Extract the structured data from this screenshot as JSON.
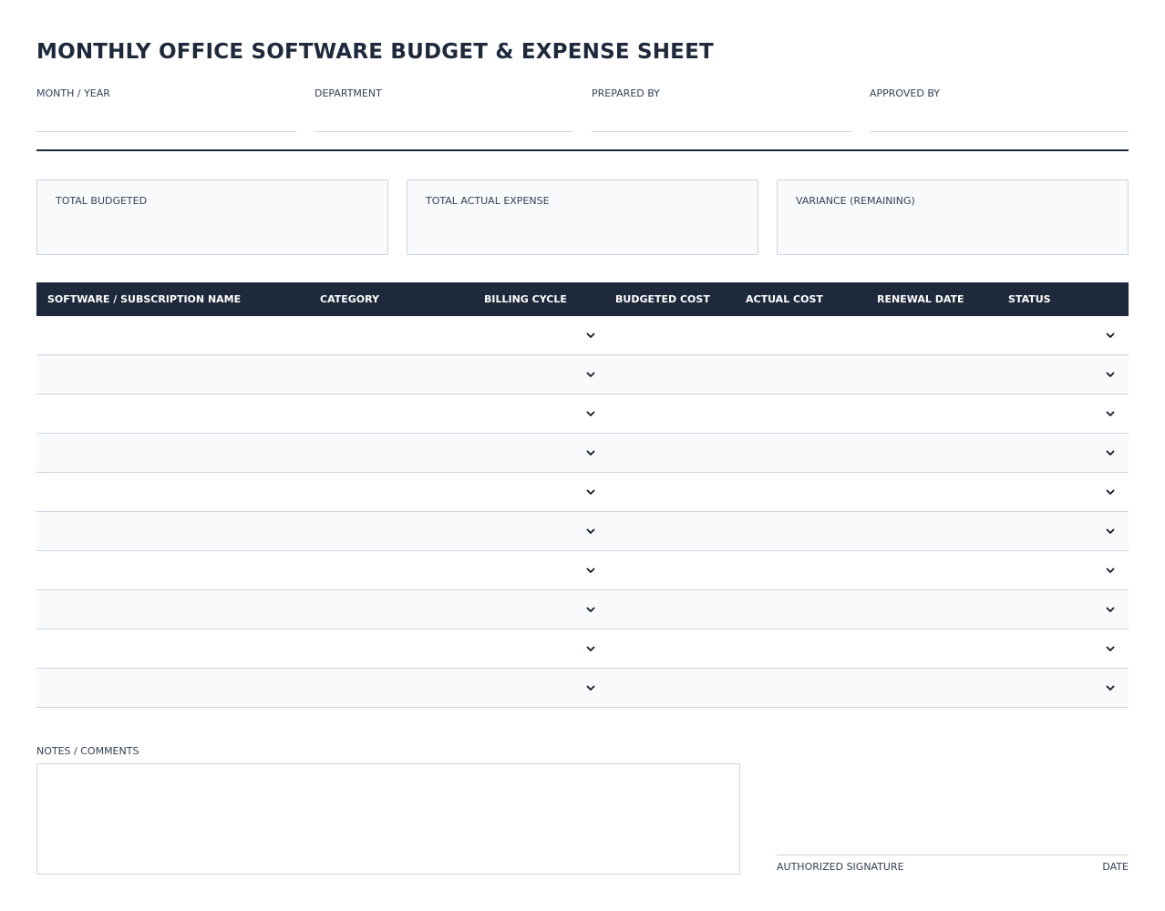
{
  "title": "MONTHLY OFFICE SOFTWARE BUDGET & EXPENSE SHEET",
  "header_fields": [
    {
      "label": "MONTH / YEAR",
      "value": ""
    },
    {
      "label": "DEPARTMENT",
      "value": ""
    },
    {
      "label": "PREPARED BY",
      "value": ""
    },
    {
      "label": "APPROVED BY",
      "value": ""
    }
  ],
  "summary": [
    {
      "label": "TOTAL BUDGETED",
      "value": ""
    },
    {
      "label": "TOTAL ACTUAL EXPENSE",
      "value": ""
    },
    {
      "label": "VARIANCE (REMAINING)",
      "value": ""
    }
  ],
  "table": {
    "columns": [
      "SOFTWARE / SUBSCRIPTION NAME",
      "CATEGORY",
      "BILLING CYCLE",
      "BUDGETED COST",
      "ACTUAL COST",
      "RENEWAL DATE",
      "STATUS"
    ],
    "row_count": 10,
    "dropdown_icon": "chevron-down-icon"
  },
  "notes": {
    "label": "NOTES / COMMENTS",
    "value": ""
  },
  "signature": {
    "label": "AUTHORIZED SIGNATURE",
    "date_label": "DATE"
  },
  "colors": {
    "header_bg": "#1e293b",
    "alt_row_bg": "#f8fafc",
    "border": "#cbd5e1",
    "text": "#1e293b"
  }
}
